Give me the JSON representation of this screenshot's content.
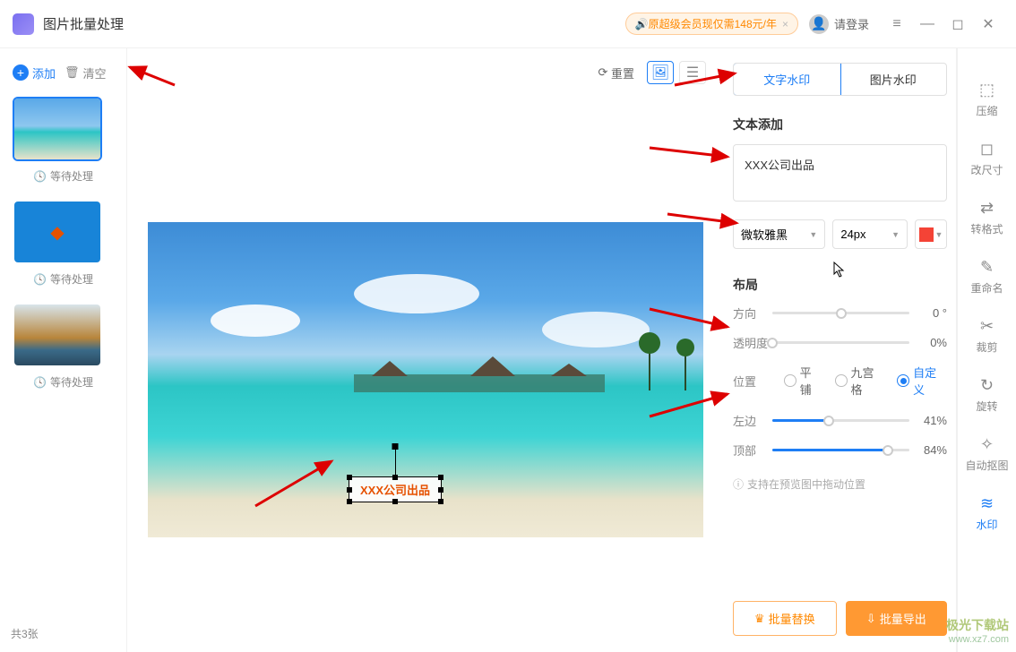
{
  "titlebar": {
    "app_title": "图片批量处理",
    "promo_text": "原超级会员现仅需148元/年",
    "login_text": "请登录"
  },
  "left": {
    "add_label": "添加",
    "clear_label": "清空",
    "thumbs": [
      {
        "status": "等待处理"
      },
      {
        "status": "等待处理"
      },
      {
        "status": "等待处理"
      }
    ],
    "footer_count": "共3张"
  },
  "center": {
    "reset_label": "重置"
  },
  "watermark": {
    "preview_text": "XXX公司出品"
  },
  "right": {
    "tabs": {
      "text": "文字水印",
      "image": "图片水印"
    },
    "text_section_title": "文本添加",
    "text_value": "XXX公司出品",
    "font_name": "微软雅黑",
    "font_size": "24px",
    "color_hex": "#f44336",
    "layout_title": "布局",
    "direction_label": "方向",
    "direction_value": "0 °",
    "opacity_label": "透明度",
    "opacity_value": "0%",
    "position_label": "位置",
    "pos_tile": "平铺",
    "pos_grid": "九宫格",
    "pos_custom": "自定义",
    "left_label": "左边",
    "left_value": "41%",
    "top_label": "顶部",
    "top_value": "84%",
    "hint": "支持在预览图中拖动位置",
    "batch_replace": "批量替换",
    "batch_export": "批量导出"
  },
  "tools": [
    {
      "label": "压缩",
      "icon": "⬚"
    },
    {
      "label": "改尺寸",
      "icon": "◻"
    },
    {
      "label": "转格式",
      "icon": "⇄"
    },
    {
      "label": "重命名",
      "icon": "✎"
    },
    {
      "label": "裁剪",
      "icon": "✂"
    },
    {
      "label": "旋转",
      "icon": "↻"
    },
    {
      "label": "自动抠图",
      "icon": "✧"
    },
    {
      "label": "水印",
      "icon": "≋",
      "active": true
    }
  ],
  "branding": {
    "cn": "极光下载站",
    "url": "www.xz7.com"
  }
}
